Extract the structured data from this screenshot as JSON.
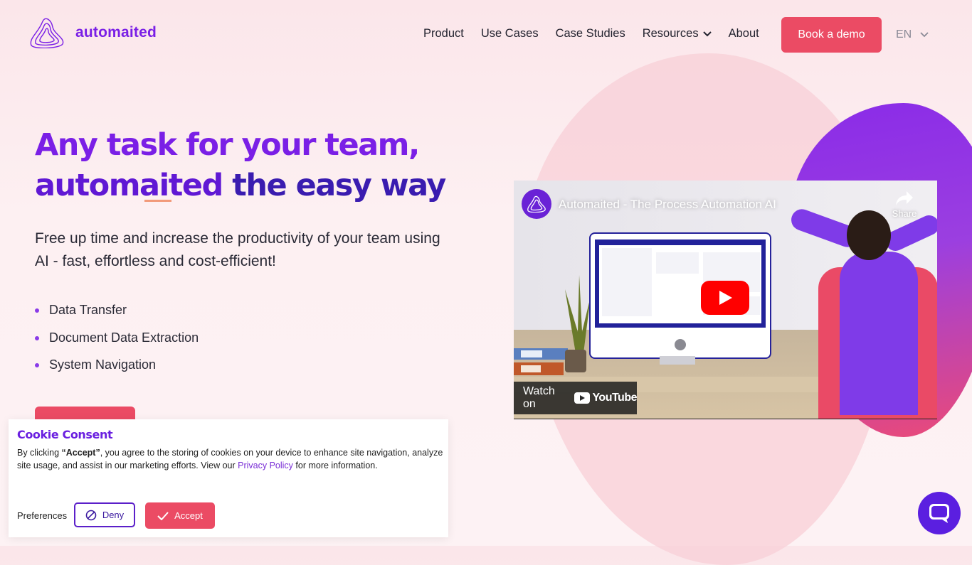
{
  "header": {
    "logo_text": "automaited",
    "nav": [
      "Product",
      "Use Cases",
      "Case Studies",
      "Resources",
      "About"
    ],
    "cta": "Book a demo",
    "language": "EN"
  },
  "hero": {
    "title_line1": "Any task for your team,",
    "title_line2_a": "automaited",
    "title_line2_b": "the easy way",
    "subtitle": "Free up time and increase the productivity of your team using AI - fast, effortless and cost-efficient!",
    "bullets": [
      "Data Transfer",
      "Document Data Extraction",
      "System Navigation"
    ]
  },
  "video": {
    "title": "Automaited - The Process Automation AI",
    "share": "Share",
    "watch_on": "Watch on",
    "youtube": "YouTube"
  },
  "cookie": {
    "title": "Cookie Consent",
    "text_pre": "By clicking ",
    "text_bold": "“Accept”",
    "text_mid": ", you agree to the storing of cookies on your device to enhance site navigation, analyze site usage, and assist in our marketing efforts. View our ",
    "link": "Privacy Policy",
    "text_post": " for more information.",
    "preferences": "Preferences",
    "deny": "Deny",
    "accept": "Accept"
  },
  "colors": {
    "brand_purple": "#7a1fe6",
    "accent_red": "#eb4b64"
  }
}
